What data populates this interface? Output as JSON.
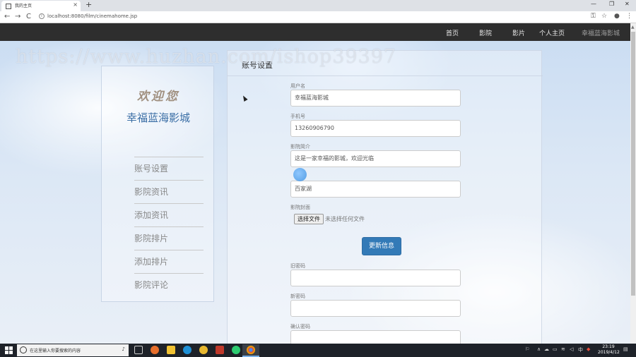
{
  "browser": {
    "tab_title": "我的主页",
    "tab_close": "×",
    "new_tab": "+",
    "url": "localhost:8080/film/cinemahome.jsp",
    "back": "←",
    "forward": "→",
    "reload": "C",
    "win_min": "—",
    "win_max": "❐",
    "win_close": "✕"
  },
  "watermark": "https://www.huzhan.com/ishop39397",
  "navbar": {
    "items": [
      "首页",
      "影院",
      "影片",
      "个人主页"
    ],
    "brand": "幸福蓝海影城"
  },
  "sidebar": {
    "welcome": "欢迎您",
    "cinema_name": "幸福蓝海影城",
    "items": [
      "账号设置",
      "影院资讯",
      "添加资讯",
      "影院排片",
      "添加排片",
      "影院评论"
    ]
  },
  "main": {
    "title": "账号设置",
    "username_label": "用户名",
    "username_value": "幸福蓝海影城",
    "phone_label": "手机号",
    "phone_value": "13260906790",
    "intro_label": "影院简介",
    "intro_value": "这是一家幸福的影城，欢迎光临",
    "address_value": "百家湖",
    "cover_label": "影院封面",
    "file_button": "选择文件",
    "file_status": "未选择任何文件",
    "update_button": "更新信息",
    "old_password_label": "旧密码",
    "new_password_label": "新密码",
    "confirm_password_label": "确认密码"
  },
  "taskbar": {
    "search_placeholder": "在这里输入你要搜索的内容",
    "time": "23:19",
    "date": "2019/4/12"
  },
  "colors": {
    "navbar_bg": "#2e2e2e",
    "primary_button": "#337ab7",
    "cinema_name": "#3a6ea5"
  }
}
